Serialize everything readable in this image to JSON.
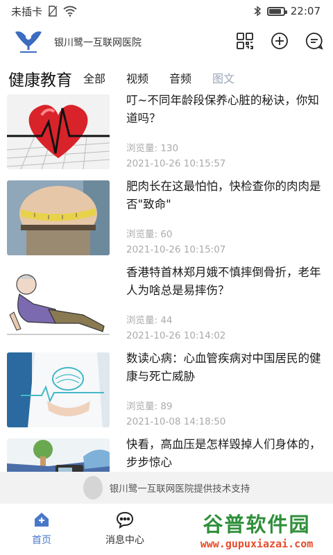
{
  "status": {
    "carrier": "未插卡",
    "time": "22:07",
    "battery_level": 0.85
  },
  "header": {
    "hospital_name": "银川鹭一互联网医院",
    "icons": [
      "qrcode-icon",
      "plus-circle-icon",
      "message-icon"
    ]
  },
  "tabs": {
    "section_title": "健康教育",
    "items": [
      {
        "label": "全部",
        "active": false
      },
      {
        "label": "视频",
        "active": false
      },
      {
        "label": "音频",
        "active": false
      },
      {
        "label": "图文",
        "active": true
      }
    ]
  },
  "articles": [
    {
      "title": "叮~不同年龄段保养心脏的秘诀，你知道吗？",
      "views": "浏览量: 130",
      "date": "2021-10-26 10:15:57",
      "thumb": "heart"
    },
    {
      "title": "肥肉长在这最怕怕，快检查你的肉肉是否\"致命\"",
      "views": "浏览量: 60",
      "date": "2021-10-26 10:15:07",
      "thumb": "waist"
    },
    {
      "title": "香港特首林郑月娥不慎摔倒骨折，老年人为啥总是易摔伤？",
      "views": "浏览量: 44",
      "date": "2021-10-26 10:14:02",
      "thumb": "fall"
    },
    {
      "title": "数读心病：心血管疾病对中国居民的健康与死亡威胁",
      "views": "浏览量: 89",
      "date": "2021-10-08 14:18:50",
      "thumb": "doctor"
    },
    {
      "title": "快看，高血压是怎样毁掉人们身体的，步步惊心",
      "views": "",
      "date": "",
      "thumb": "bp"
    }
  ],
  "support": {
    "text": "银川鹭一互联网医院提供技术支持"
  },
  "bottom_nav": [
    {
      "label": "首页",
      "icon": "home-icon",
      "active": true
    },
    {
      "label": "消息中心",
      "icon": "chat-icon",
      "active": false
    },
    {
      "label": "",
      "icon": "",
      "active": false
    },
    {
      "label": "",
      "icon": "",
      "active": false
    }
  ],
  "watermark": {
    "title": "谷普软件园",
    "url": "www.gupuxiazai.com"
  },
  "colors": {
    "accent": "#4a78c9",
    "tab_active": "#9aa7b8",
    "meta_text": "#aaaaaa"
  }
}
